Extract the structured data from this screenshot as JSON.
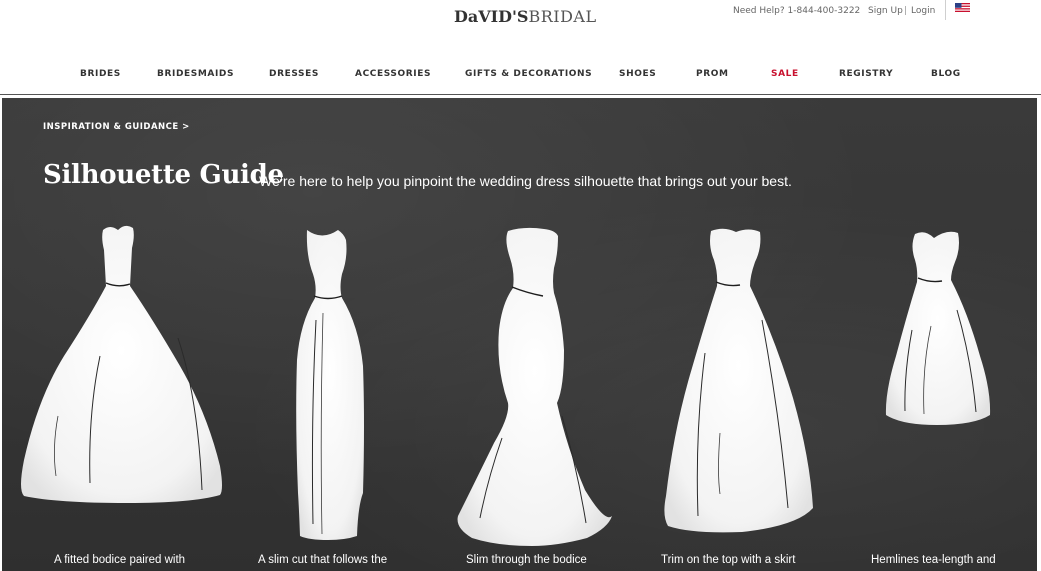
{
  "header": {
    "logo_bold": "DaVID'S",
    "logo_light": "BRIDAL",
    "help_text": "Need Help? 1-844-400-3222",
    "signup": "Sign Up",
    "separator": "|",
    "login": "Login",
    "flag_icon": "us-flag-icon"
  },
  "nav": {
    "items": [
      {
        "label": "BRIDES"
      },
      {
        "label": "BRIDESMAIDS"
      },
      {
        "label": "DRESSES"
      },
      {
        "label": "ACCESSORIES"
      },
      {
        "label": "GIFTS & DECORATIONS"
      },
      {
        "label": "SHOES"
      },
      {
        "label": "PROM"
      },
      {
        "label": "SALE"
      },
      {
        "label": "REGISTRY"
      },
      {
        "label": "BLOG"
      }
    ],
    "sale_color": "#c8102e"
  },
  "hero": {
    "breadcrumb": "INSPIRATION & GUIDANCE >",
    "title": "Silhouette Guide",
    "subtitle": "We’re here to help you pinpoint the wedding dress silhouette that brings out your best.",
    "background_color": "#373737",
    "dresses": [
      {
        "icon": "ball-gown-dress-icon",
        "caption": "A fitted bodice paired with"
      },
      {
        "icon": "sheath-dress-icon",
        "caption": "A slim cut that follows the"
      },
      {
        "icon": "mermaid-dress-icon",
        "caption": "Slim through the bodice"
      },
      {
        "icon": "a-line-dress-icon",
        "caption": "Trim on the top with a skirt"
      },
      {
        "icon": "tea-length-dress-icon",
        "caption": "Hemlines tea-length and"
      }
    ]
  }
}
